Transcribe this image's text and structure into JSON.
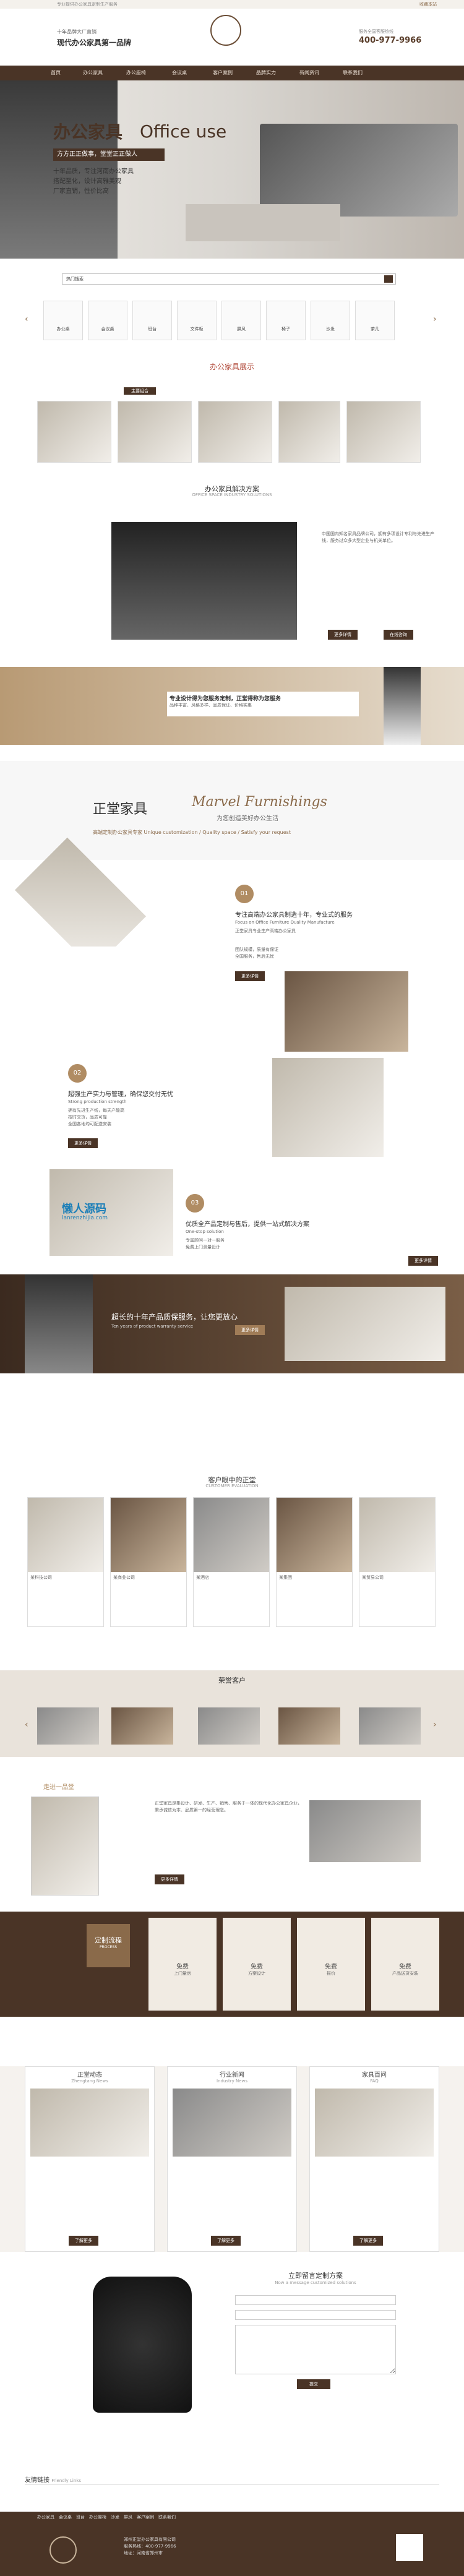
{
  "topbar": {
    "left": "专业提供办公家具定制生产服务",
    "right": "收藏本站"
  },
  "header": {
    "slogan_top": "十年品牌大厂直销",
    "slogan": "现代办公家具第一品牌",
    "hotline_label": "服务全国客服热线",
    "hotline": "400-977-9966"
  },
  "nav": [
    "首页",
    "办公家具",
    "办公座椅",
    "会议桌",
    "客户案例",
    "品牌实力",
    "新闻资讯",
    "联系我们"
  ],
  "banner": {
    "title_cn": "办公家具",
    "title_en": "Office use",
    "sub": "方方正正做事，堂堂正正做人",
    "points": [
      "十年品质，专注河南办公家具",
      "搭配至化，设计高雅美观",
      "厂家直销，性价比高"
    ]
  },
  "search": {
    "label": "热门搜索",
    "placeholder": ""
  },
  "categories": [
    "办公桌",
    "会议桌",
    "班台",
    "文件柜",
    "屏风",
    "椅子",
    "沙发",
    "茶几",
    "接待台"
  ],
  "showcase": {
    "title": "办公家具展示",
    "tabs": [
      "主要组合",
      "",
      "",
      "",
      "",
      ""
    ]
  },
  "solution": {
    "title": "办公家具解决方案",
    "en": "OFFICE SPACE INDUSTRY SOLUTIONS",
    "body": "中国国内知名家具品牌公司，拥有多项设计专利与先进生产线，服务过众多大型企业与机关单位。",
    "btn1": "更多详情",
    "btn2": "在线咨询"
  },
  "pro": {
    "line1": "专业设计得为您服务定制，正堂得称为您服务",
    "line2": "品种丰富、风格多样、品质保证、价格实惠"
  },
  "marvel": {
    "cn": "正堂家具",
    "en": "Marvel Furnishings",
    "en2": "为您创造美好办公生活",
    "sub": "高端定制办公家具专家 Unique customization / Quality space / Satisfy your request"
  },
  "f1": {
    "num": "01",
    "title": "专注高端办公家具制造十年，专业式的服务",
    "en": "Focus on Office Furniture Quality Manufacture",
    "points": [
      "正堂家具专业生产高端办公家具",
      "团队规模，质量有保证",
      "全国服务，售后无忧"
    ],
    "btn": "更多详情"
  },
  "f2": {
    "num": "02",
    "title": "超强生产实力与管理，确保您交付无忧",
    "en": "Strong production strength",
    "points": [
      "拥有先进生产线，每天产能高",
      "按时交货，品质可靠",
      "全国各地均可配送安装"
    ],
    "btn": "更多详情"
  },
  "f3": {
    "num": "03",
    "title": "优质全产品定制与售后，提供一站式解决方案",
    "en": "One-stop solution",
    "points": [
      "专属顾问一对一服务",
      "免费上门测量设计"
    ],
    "btn": "更多详情"
  },
  "watermark": {
    "cn": "懒人源码",
    "url": "lanrenzhijia.com"
  },
  "tenyear": {
    "line": "超长的十年产品质保服务，让您更放心",
    "sub": "Ten years of product warranty service",
    "btn": "更多详情"
  },
  "cases": {
    "title": "客户眼中的正堂",
    "en": "CUSTOMER EVALUATION",
    "items": [
      {
        "name": "某科技公司"
      },
      {
        "name": "某商业公司"
      },
      {
        "name": "某酒店"
      },
      {
        "name": "某集团"
      },
      {
        "name": "某贸易公司"
      }
    ]
  },
  "partners": {
    "title": "荣誉客户"
  },
  "about": {
    "title": "走进一品堂",
    "body": "正堂家具是集设计、研发、生产、销售、服务于一体的现代化办公家具企业，秉承诚信为本、品质第一的经营理念。",
    "btn": "更多详情"
  },
  "custom": {
    "title": "定制流程",
    "en": "PROCESS",
    "steps": [
      {
        "t": "免费",
        "d": "上门量房"
      },
      {
        "t": "免费",
        "d": "方案设计"
      },
      {
        "t": "免费",
        "d": "报价"
      },
      {
        "t": "免费",
        "d": "产品送货安装"
      }
    ]
  },
  "news": [
    {
      "title": "正堂动态",
      "en": "Zhengtang News",
      "btn": "了解更多"
    },
    {
      "title": "行业新闻",
      "en": "Industry News",
      "btn": "了解更多"
    },
    {
      "title": "家具百问",
      "en": "FAQ",
      "btn": "了解更多"
    }
  ],
  "message": {
    "title": "立即留言定制方案",
    "en": "Now a message customized solutions",
    "btn": "提交"
  },
  "links": {
    "title": "友情链接",
    "en": "Friendly Links"
  },
  "footer": {
    "nav": [
      "办公家具",
      "会议桌",
      "班台",
      "办公座椅",
      "沙发",
      "屏风",
      "客户案例",
      "联系我们"
    ],
    "line1": "郑州正堂办公家具有限公司",
    "line2": "服务热线：400-977-9966",
    "line3": "地址：河南省郑州市"
  }
}
